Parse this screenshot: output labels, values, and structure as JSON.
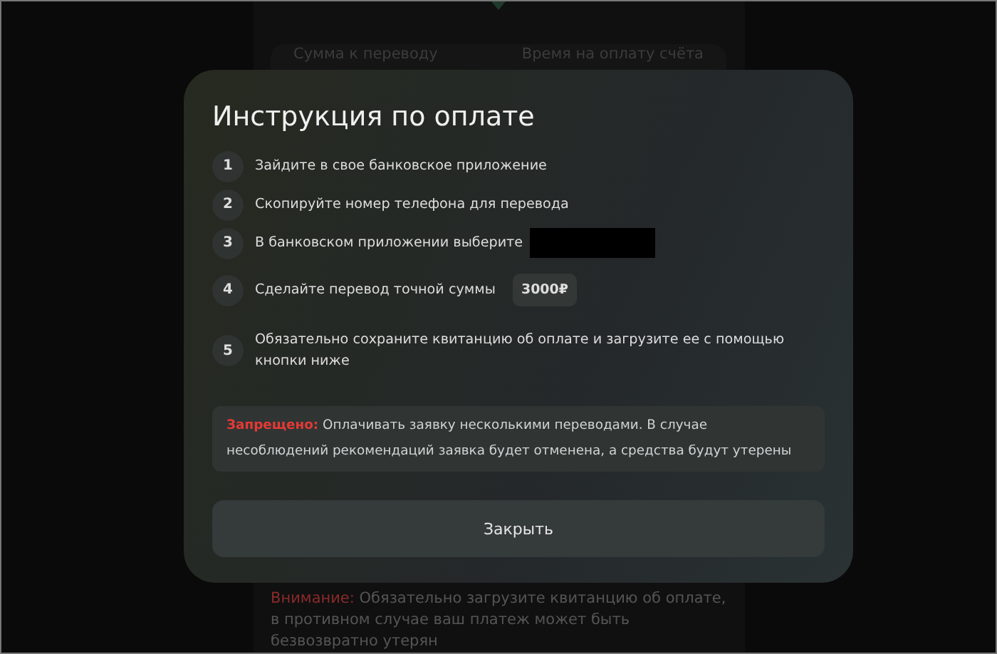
{
  "background": {
    "summary_labels": [
      "Сумма к переводу",
      "Время на оплату счёта"
    ],
    "notice": {
      "label": "Внимание:",
      "text": "Обязательно загрузите квитанцию об оплате, в противном случае ваш платеж может быть безвозвратно утерян"
    }
  },
  "dialog": {
    "title": "Инструкция по оплате",
    "steps": [
      {
        "number": "1",
        "text": "Зайдите в свое банковское приложение",
        "redacted": false
      },
      {
        "number": "2",
        "text": "Скопируйте номер телефона для перевода",
        "redacted": false
      },
      {
        "number": "3",
        "text": "В банковском приложении выберите",
        "redacted": true
      },
      {
        "number": "4",
        "text": "Сделайте перевод точной суммы",
        "amount": "3000₽",
        "redacted": false
      },
      {
        "number": "5",
        "text": "Обязательно сохраните квитанцию об оплате и загрузите ее с помощью кнопки ниже",
        "redacted": false
      }
    ],
    "warning": {
      "label": "Запрещено:",
      "text": "Оплачивать заявку несколькими переводами. В случае несоблюдений рекомендаций заявка будет отменена, а средства будут утерены"
    },
    "close_button": "Закрыть"
  }
}
